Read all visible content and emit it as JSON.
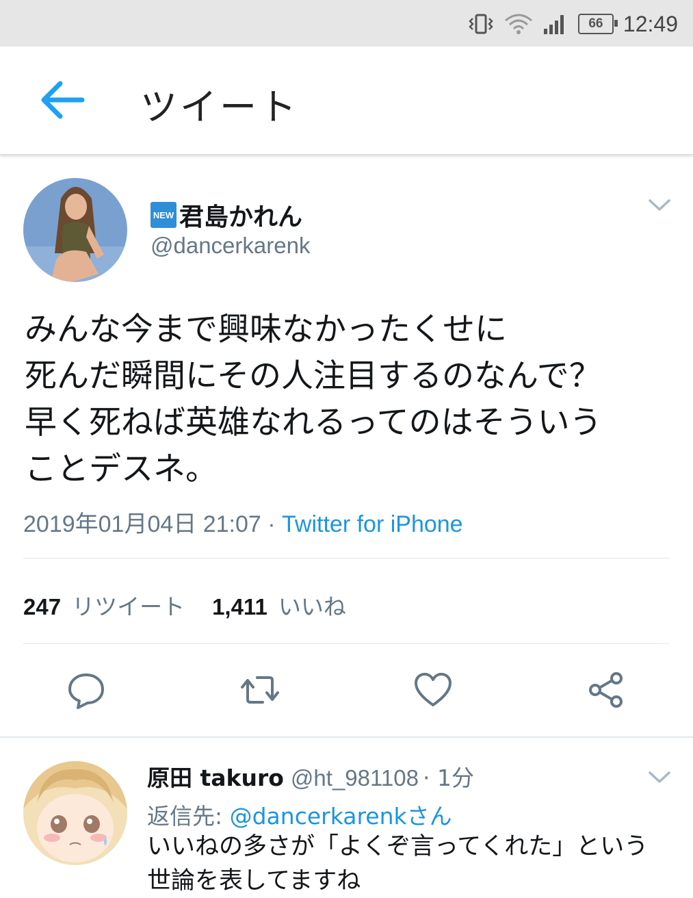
{
  "status_bar": {
    "battery": "66",
    "time": "12:49"
  },
  "header": {
    "title": "ツイート"
  },
  "tweet": {
    "badge": "NEW",
    "display_name": "君島かれん",
    "handle": "@dancerkarenk",
    "text_lines": [
      "みんな今まで興味なかったくせに",
      "死んだ瞬間にその人注目するのなんで？",
      "早く死ねば英雄なれるってのはそういう",
      "ことデスネ。"
    ],
    "timestamp": "2019年01月04日 21:07",
    "separator": " · ",
    "source": "Twitter for iPhone",
    "retweet_count": "247",
    "retweet_label": "リツイート",
    "like_count": "1,411",
    "like_label": "いいね"
  },
  "reply": {
    "display_name": "原田 takuro",
    "handle": "@ht_981108",
    "time": "· 1分",
    "reply_to_prefix": "返信先: ",
    "reply_to_handle": "@dancerkarenkさん",
    "text_lines": [
      "いいねの多さが「よくぞ言ってくれた」という",
      "世論を表してますね"
    ]
  },
  "colors": {
    "accent": "#1b95e0",
    "muted": "#657786",
    "text": "#14171a",
    "status_bar": "#e6e6e6"
  },
  "icons": [
    "vibrate-icon",
    "wifi-icon",
    "signal-icon",
    "battery-icon",
    "back-arrow-icon",
    "chevron-down-icon",
    "reply-icon",
    "retweet-icon",
    "like-icon",
    "share-icon"
  ]
}
